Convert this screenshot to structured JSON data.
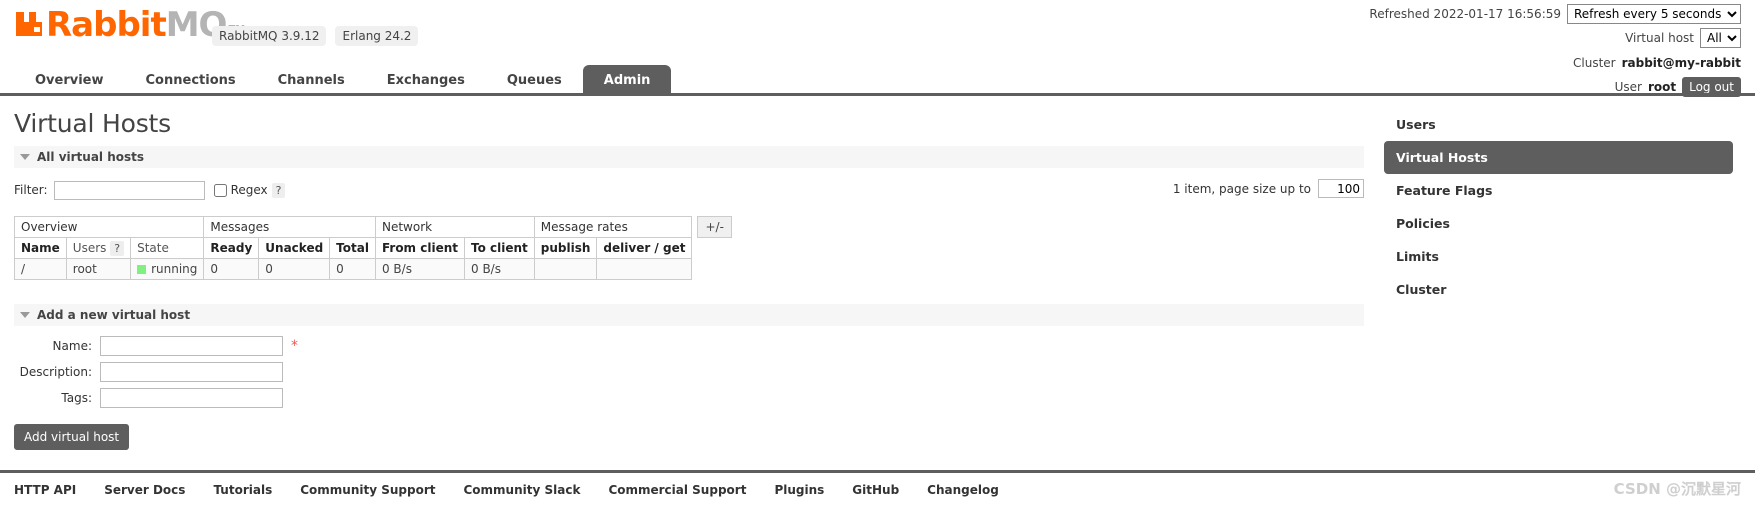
{
  "header": {
    "logo_rabbit": "Rabbit",
    "logo_mq": "MQ",
    "logo_tm": "TM",
    "badges": [
      "RabbitMQ 3.9.12",
      "Erlang 24.2"
    ],
    "refreshed_label": "Refreshed 2022-01-17 16:56:59",
    "refresh_select": "Refresh every 5 seconds",
    "vhost_label": "Virtual host",
    "vhost_select": "All",
    "cluster_label": "Cluster",
    "cluster_name": "rabbit@my-rabbit",
    "user_label": "User",
    "user_name": "root",
    "logout_label": "Log out"
  },
  "nav": {
    "tabs": [
      {
        "label": "Overview",
        "active": false
      },
      {
        "label": "Connections",
        "active": false
      },
      {
        "label": "Channels",
        "active": false
      },
      {
        "label": "Exchanges",
        "active": false
      },
      {
        "label": "Queues",
        "active": false
      },
      {
        "label": "Admin",
        "active": true
      }
    ]
  },
  "main": {
    "page_title": "Virtual Hosts",
    "all_vhosts_section": "All virtual hosts",
    "filter_label": "Filter:",
    "filter_value": "",
    "regex_label": "Regex",
    "help_mark": "?",
    "pager_text": "1 item, page size up to",
    "page_size": "100",
    "plusminus": "+/-",
    "table": {
      "groups": [
        {
          "label": "Overview",
          "span": 3
        },
        {
          "label": "Messages",
          "span": 3
        },
        {
          "label": "Network",
          "span": 2
        },
        {
          "label": "Message rates",
          "span": 2
        }
      ],
      "columns": [
        {
          "label": "Name",
          "bold": true,
          "align": "left"
        },
        {
          "label": "Users",
          "bold": false,
          "align": "left"
        },
        {
          "label": "State",
          "bold": false,
          "align": "left"
        },
        {
          "label": "Ready",
          "bold": true,
          "align": "right"
        },
        {
          "label": "Unacked",
          "bold": true,
          "align": "right"
        },
        {
          "label": "Total",
          "bold": true,
          "align": "right"
        },
        {
          "label": "From client",
          "bold": true,
          "align": "left"
        },
        {
          "label": "To client",
          "bold": true,
          "align": "left"
        },
        {
          "label": "publish",
          "bold": true,
          "align": "left"
        },
        {
          "label": "deliver / get",
          "bold": true,
          "align": "left"
        }
      ],
      "users_help": "?",
      "rows": [
        {
          "name": "/",
          "users": "root",
          "state": "running",
          "ready": "0",
          "unacked": "0",
          "total": "0",
          "from_client": "0 B/s",
          "to_client": "0 B/s",
          "publish": "",
          "deliver_get": ""
        }
      ]
    },
    "add_section": "Add a new virtual host",
    "form": {
      "name_label": "Name:",
      "name_value": "",
      "required_mark": "*",
      "description_label": "Description:",
      "description_value": "",
      "tags_label": "Tags:",
      "tags_value": "",
      "submit_label": "Add virtual host"
    }
  },
  "sidebar": {
    "items": [
      {
        "label": "Users",
        "active": false
      },
      {
        "label": "Virtual Hosts",
        "active": true
      },
      {
        "label": "Feature Flags",
        "active": false
      },
      {
        "label": "Policies",
        "active": false
      },
      {
        "label": "Limits",
        "active": false
      },
      {
        "label": "Cluster",
        "active": false
      }
    ]
  },
  "footer": {
    "links": [
      "HTTP API",
      "Server Docs",
      "Tutorials",
      "Community Support",
      "Community Slack",
      "Commercial Support",
      "Plugins",
      "GitHub",
      "Changelog"
    ],
    "watermark": "CSDN @沉默星河"
  },
  "colors": {
    "accent": "#f60",
    "dark": "#5e5e5e",
    "running": "#80f080"
  }
}
